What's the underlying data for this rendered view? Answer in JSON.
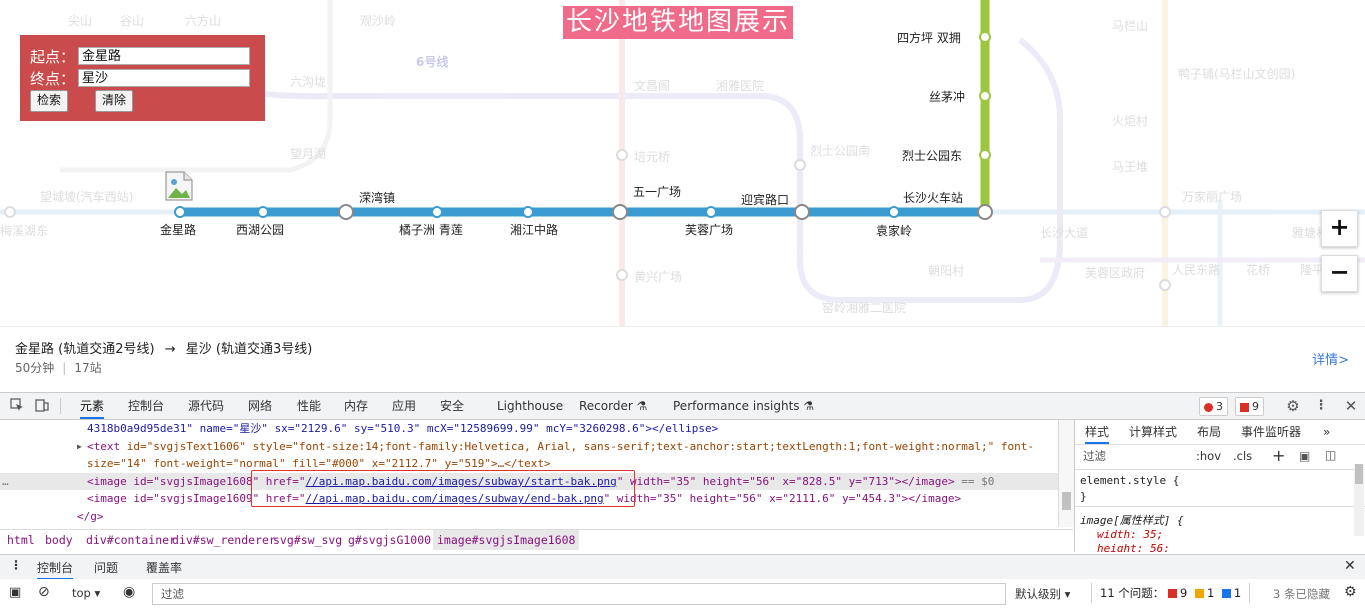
{
  "map": {
    "title": "长沙地铁地图展示",
    "colors": {
      "line2": "#3a9bd0",
      "line3": "#9cc63d",
      "title_bg": "#f06a8a",
      "panel_bg": "#c94b4b"
    },
    "search": {
      "start_label": "起点：",
      "start_value": "金星路",
      "end_label": "终点：",
      "end_value": "星沙",
      "search_button": "检索",
      "clear_button": "清除"
    },
    "line2_stations_below": [
      "金星路",
      "西湖公园",
      "橘子洲 青莲",
      "湘江中路",
      "芙蓉广场",
      "袁家岭"
    ],
    "line2_stations_above": [
      "溁湾镇",
      "五一广场",
      "迎宾路口",
      "长沙火车站"
    ],
    "line3_stations": [
      "四方坪 双拥",
      "丝茅冲",
      "烈士公园东"
    ],
    "faded_labels": [
      "尖山",
      "谷山",
      "六方山",
      "观沙岭",
      "6号线",
      "六沟垅",
      "文昌阁",
      "湘雅医院",
      "望月湖",
      "培元桥",
      "烈士公园南",
      "望城坡(汽车西站)",
      "黄兴广场",
      "朝阳村",
      "窑岭湘雅二医院",
      "马栏山",
      "鸭子铺(马栏山文创园)",
      "火炬村",
      "马王堆",
      "万家丽广场",
      "长沙大道",
      "人民东路",
      "花桥",
      "芙蓉区政府",
      "隆平",
      "梅溪湖东",
      "雅塘村"
    ],
    "zoom_in": "+",
    "zoom_out": "−"
  },
  "route": {
    "from": "金星路 (轨道交通2号线)",
    "arrow": "→",
    "to": "星沙 (轨道交通3号线)",
    "duration": "50分钟",
    "stops": "17站",
    "detail_link": "详情>"
  },
  "devtools": {
    "tabs": [
      "元素",
      "控制台",
      "源代码",
      "网络",
      "性能",
      "内存",
      "应用",
      "安全",
      "Lighthouse",
      "Recorder",
      "Performance insights"
    ],
    "errors": "3",
    "issues": "9",
    "dom_lines": {
      "l1": "4318b0a9d95de31\" name=\"星沙\" sx=\"2129.6\" sy=\"510.3\" mcX=\"12589699.99\" mcY=\"3260298.6\"></ellipse>",
      "l2_tag": "<text",
      "l2_attrs": " id=\"svgjsText1606\" style=\"font-size:14;font-family:Helvetica, Arial, sans-serif;text-anchor:start;textLength:1;font-weight:normal;\" font-",
      "l3": "size=\"14\" font-weight=\"normal\" fill=\"#000\" x=\"2112.7\" y=\"519\">…</text>",
      "l4_a": "<image id=\"svgjsImage1608\" href=\"",
      "l4_link": "//api.map.baidu.com/images/subway/start-bak.png",
      "l4_b": "\" width=\"35\" height=\"56\" x=\"828.5\" y=\"713\"></image>",
      "l4_suffix": "== $0",
      "l5_a": "<image id=\"svgjsImage1609\" href=\"",
      "l5_link": "//api.map.baidu.com/images/subway/end-bak.png",
      "l5_b": "\" width=\"35\" height=\"56\" x=\"2111.6\" y=\"454.3\"></image>",
      "l6": "</g>",
      "ellipsis": "…"
    },
    "breadcrumbs": [
      "html",
      "body",
      "div#container",
      "div#sw_renderer",
      "svg#sw_svg",
      "g#svgjsG1000",
      "image#svgjsImage1608"
    ],
    "styles_tabs": [
      "样式",
      "计算样式",
      "布局",
      "事件监听器",
      "»"
    ],
    "filter_placeholder": "过滤",
    "hov": ":hov",
    "cls": ".cls",
    "css_lines": [
      "element.style {",
      "}",
      "image[属性样式] {",
      "width: 35;",
      "height: 56;"
    ],
    "console_tabs": [
      "控制台",
      "问题",
      "覆盖率"
    ],
    "console": {
      "context": "top",
      "filter_placeholder": "过滤",
      "level": "默认级别",
      "issues_label": "11 个问题：",
      "issue_counts": [
        "9",
        "1",
        "1"
      ],
      "hidden": "3 条已隐藏"
    }
  }
}
